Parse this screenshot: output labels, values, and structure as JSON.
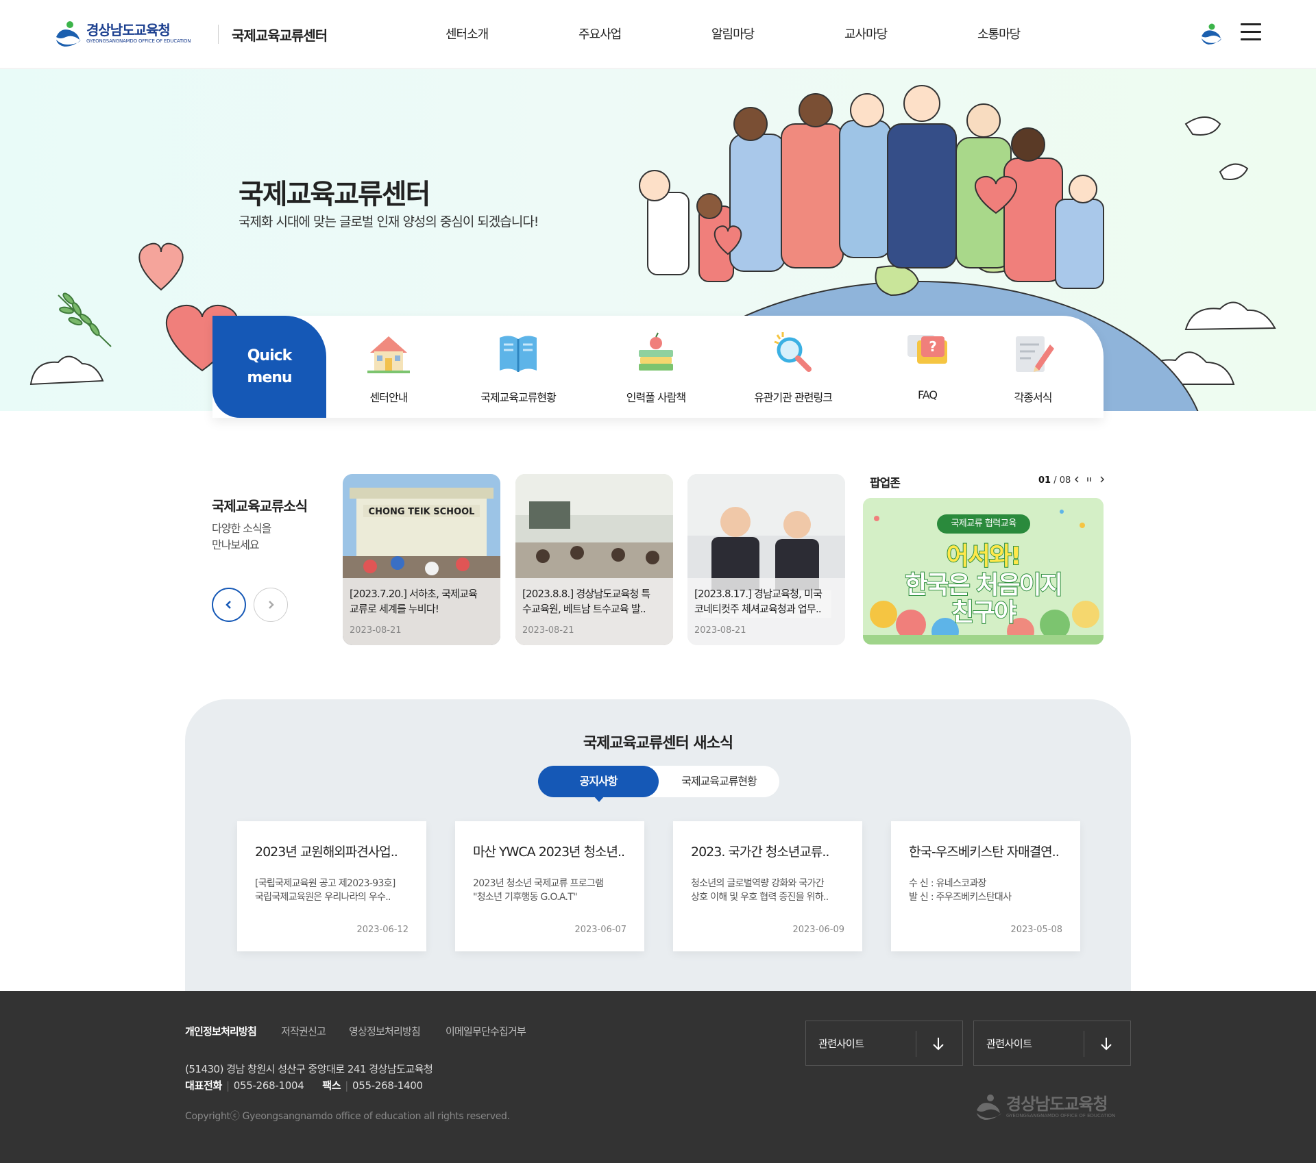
{
  "header": {
    "logo_korean": "경상남도교육청",
    "logo_english": "GYEONGSANGNAMDO OFFICE OF EDUCATION",
    "site_title": "국제교육교류센터",
    "nav": [
      "센터소개",
      "주요사업",
      "알림마당",
      "교사마당",
      "소통마당"
    ]
  },
  "hero": {
    "title": "국제교육교류센터",
    "subtitle": "국제화 시대에 맞는 글로벌 인재 양성의 중심이 되겠습니다!"
  },
  "quick_menu": {
    "label_line1": "Quick",
    "label_line2": "menu",
    "items": [
      {
        "label": "센터안내",
        "icon": "house-icon"
      },
      {
        "label": "국제교육교류현황",
        "icon": "book-icon"
      },
      {
        "label": "인력풀 사람책",
        "icon": "books-apple-icon"
      },
      {
        "label": "유관기관 관련링크",
        "icon": "magnifier-icon"
      },
      {
        "label": "FAQ",
        "icon": "question-bubble-icon"
      },
      {
        "label": "각종서식",
        "icon": "form-pencil-icon"
      }
    ]
  },
  "news": {
    "title": "국제교육교류소식",
    "desc_line1": "다양한 소식을",
    "desc_line2": "만나보세요",
    "cards": [
      {
        "line1": "[2023.7.20.] 서하초, 국제교육",
        "line2": "교류로 세계를 누비다!",
        "date": "2023-08-21",
        "sign": "CHONG TEIK SCHOOL"
      },
      {
        "line1": "[2023.8.8.] 경상남도교육청 특",
        "line2": "수교육원, 베트남 트수교육 발..",
        "date": "2023-08-21"
      },
      {
        "line1": "[2023.8.17.] 경남교육청, 미국",
        "line2": "코네티컷주 체셔교육청과 업무..",
        "date": "2023-08-21"
      }
    ]
  },
  "popup": {
    "title": "팝업존",
    "current": "01",
    "total": "/ 08",
    "badge": "국제교류 협력교육",
    "line1": "어서와!",
    "line2": "한국은 처음이지",
    "line3": "친구야"
  },
  "notice": {
    "title": "국제교육교류센터 새소식",
    "tabs": [
      "공지사항",
      "국제교육교류현황"
    ],
    "cards": [
      {
        "title": "2023년 교원해외파견사업..",
        "desc1": "[국립국제교육원 공고 제2023-93호]",
        "desc2": "국립국제교육원은 우리나라의 우수..",
        "date": "2023-06-12"
      },
      {
        "title": "마산 YWCA 2023년 청소년..",
        "desc1": "2023년 청소년 국제교류 프로그램",
        "desc2": "\"청소년 기후행동 G.O.A.T\"",
        "date": "2023-06-07"
      },
      {
        "title": "2023. 국가간 청소년교류..",
        "desc1": "청소년의 글로벌역량 강화와 국가간",
        "desc2": "상호 이해 및 우호 협력 증진을 위하..",
        "date": "2023-06-09"
      },
      {
        "title": "한국-우즈베키스탄 자매결연..",
        "desc1": "수 신 : 유네스코과장",
        "desc2": "발 신 : 주우즈베키스탄대사",
        "date": "2023-05-08"
      }
    ]
  },
  "footer": {
    "links": [
      "개인정보처리방침",
      "저작권신고",
      "영상정보처리방침",
      "이메일무단수집거부"
    ],
    "address": "(51430) 경남 창원시 성산구 중앙대로 241 경상남도교육청",
    "tel_label": "대표전화",
    "tel": "055-268-1004",
    "fax_label": "팩스",
    "fax": "055-268-1400",
    "copyright": "Copyrightⓒ Gyeongsangnamdo office of education all rights reserved.",
    "related1": "관련사이트",
    "related2": "관련사이트",
    "logo_korean": "경상남도교육청",
    "logo_english": "GYEONGSANGNAMDO OFFICE OF EDUCATION"
  },
  "colors": {
    "primary": "#1558b6",
    "footer_bg": "#333333",
    "section_bg": "#e9edf0"
  }
}
